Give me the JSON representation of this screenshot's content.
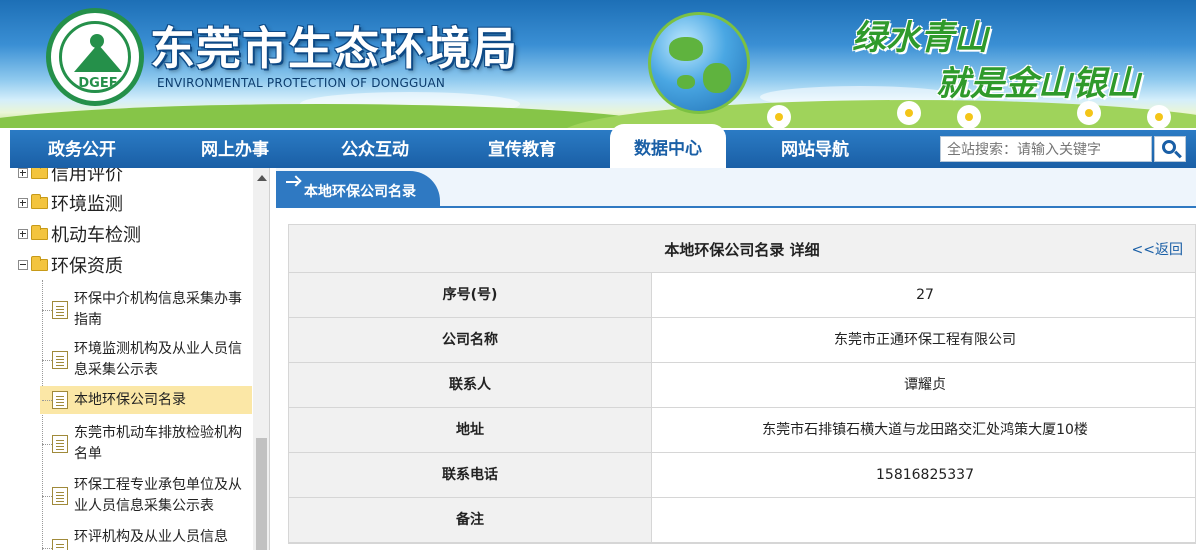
{
  "header": {
    "title": "东莞市生态环境局",
    "subtitle": "ENVIRONMENTAL PROTECTION OF DONGGUAN",
    "logo_text": "DGEE",
    "slogan_line1": "绿水青山",
    "slogan_line2": "就是金山银山"
  },
  "nav": {
    "items": [
      {
        "label": "政务公开"
      },
      {
        "label": "网上办事"
      },
      {
        "label": "公众互动"
      },
      {
        "label": "宣传教育"
      },
      {
        "label": "数据中心"
      },
      {
        "label": "网站导航"
      }
    ],
    "active_index": 4,
    "search_placeholder": "全站搜索：请输入关键字"
  },
  "sidebar": {
    "nodes": [
      {
        "label": "信用评价",
        "state": "plus"
      },
      {
        "label": "环境监测",
        "state": "plus"
      },
      {
        "label": "机动车检测",
        "state": "plus"
      },
      {
        "label": "环保资质",
        "state": "minus"
      }
    ],
    "leaves": [
      {
        "label": "环保中介机构信息采集办事指南"
      },
      {
        "label": "环境监测机构及从业人员信息采集公示表"
      },
      {
        "label": "本地环保公司名录",
        "selected": true
      },
      {
        "label": "东莞市机动车排放检验机构名单"
      },
      {
        "label": "环保工程专业承包单位及从业人员信息采集公示表"
      },
      {
        "label": "环评机构及从业人员信息"
      }
    ]
  },
  "main": {
    "tab_label": "本地环保公司名录",
    "detail_title": "本地环保公司名录  详细",
    "back_label": "<<返回",
    "rows": [
      {
        "key": "序号(号)",
        "value": "27"
      },
      {
        "key": "公司名称",
        "value": "东莞市正通环保工程有限公司"
      },
      {
        "key": "联系人",
        "value": "谭耀贞"
      },
      {
        "key": "地址",
        "value": "东莞市石排镇石横大道与龙田路交汇处鸿策大厦10楼"
      },
      {
        "key": "联系电话",
        "value": "15816825337"
      },
      {
        "key": "备注",
        "value": ""
      }
    ]
  },
  "colors": {
    "nav_blue": "#1a5fa6",
    "title_green": "#2f9a2b",
    "selected_bg": "#fbe7a6"
  }
}
